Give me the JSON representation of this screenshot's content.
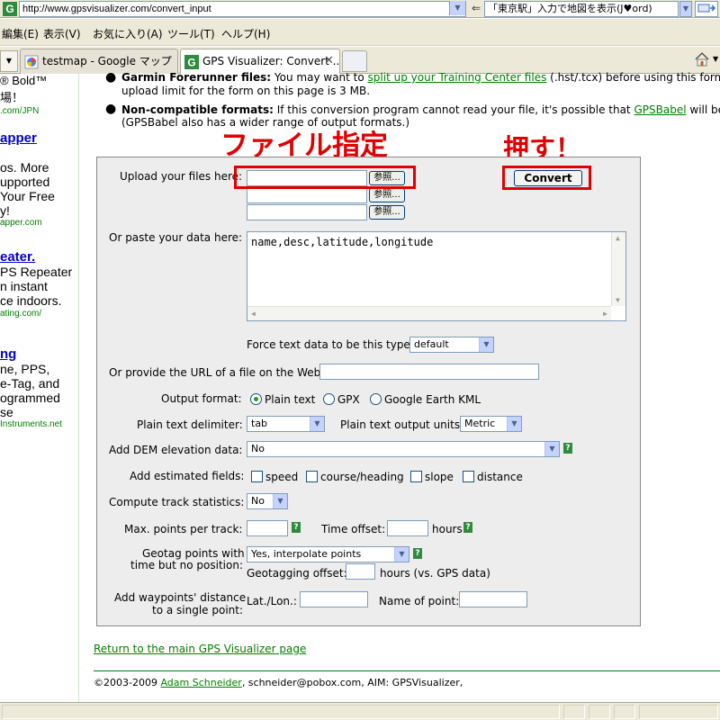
{
  "browser": {
    "url": "http://www.gpsvisualizer.com/convert_input",
    "search_text": "「東京駅」入力で地図を表示(J♥ord)",
    "menu": [
      "編集(E)",
      "表示(V)",
      "お気に入り(A)",
      "ツール(T)",
      "ヘルプ(H)"
    ],
    "tabs": [
      {
        "title": "testmap - Google マップ"
      },
      {
        "title": "GPS Visualizer: Convert ..."
      }
    ]
  },
  "left_ads": {
    "lines": [
      {
        "text": "® Bold™"
      },
      {
        "text": "場！"
      },
      {
        "text": ".com/JPN"
      },
      {
        "text": "apper"
      },
      {
        "text": "os. More"
      },
      {
        "text": "upported"
      },
      {
        "text": "Your Free"
      },
      {
        "text": "y!"
      },
      {
        "text": "apper.com"
      },
      {
        "text": "eater."
      },
      {
        "text": "PS Repeater"
      },
      {
        "text": "n instant"
      },
      {
        "text": "ce indoors."
      },
      {
        "text": "ating.com/"
      },
      {
        "text": "ng"
      },
      {
        "text": "ne, PPS,"
      },
      {
        "text": "e-Tag, and"
      },
      {
        "text": "ogrammed"
      },
      {
        "text": "se"
      },
      {
        "text": "Instruments.net"
      }
    ]
  },
  "intro": {
    "garmin_label": "Garmin Forerunner files:",
    "garmin_text": "You may want to",
    "garmin_link": "split up your Training Center files",
    "garmin_text2": "(.hst/.tcx) before using this form. Th",
    "upload_limit": "upload limit for the form on this page is 3 MB.",
    "noncompat_label": "Non-compatible formats:",
    "noncompat_text": "If this conversion program cannot read your file, it's possible that",
    "noncompat_link": "GPSBabel",
    "noncompat_text2": "will be able",
    "noncompat_line2": "(GPSBabel also has a wider range of output formats.)"
  },
  "annotations": {
    "file_spec": "ファイル指定",
    "press": "押す！"
  },
  "form": {
    "upload_label": "Upload your files here:",
    "browse_label": "参照...",
    "convert_label": "Convert",
    "paste_label": "Or paste your data here:",
    "paste_value": "name,desc,latitude,longitude",
    "force_type_label": "Force text data to be this type:",
    "force_type_value": "default",
    "url_label": "Or provide the URL of a file on the Web:",
    "url_value": "",
    "output_format_label": "Output format:",
    "output_options": [
      "Plain text",
      "GPX",
      "Google Earth KML"
    ],
    "output_selected": "Plain text",
    "delimiter_label": "Plain text delimiter:",
    "delimiter_value": "tab",
    "units_label": "Plain text output units:",
    "units_value": "Metric",
    "dem_label": "Add DEM elevation data:",
    "dem_value": "No",
    "estimated_label": "Add estimated fields:",
    "estimated_options": [
      "speed",
      "course/heading",
      "slope",
      "distance"
    ],
    "stats_label": "Compute track statistics:",
    "stats_value": "No",
    "maxpoints_label": "Max. points per track:",
    "maxpoints_value": "",
    "timeoffset_label": "Time offset:",
    "timeoffset_value": "",
    "hours_label": "hours",
    "geotag_label1": "Geotag points with",
    "geotag_label2": "time but no position:",
    "geotag_value": "Yes, interpolate points",
    "geotag_offset_label": "Geotagging offset:",
    "geotag_offset_value": "",
    "geotag_hours_label": "hours (vs. GPS data)",
    "waypoint_label1": "Add waypoints' distance",
    "waypoint_label2": "to a single point:",
    "latlon_label": "Lat./Lon.:",
    "latlon_value": "",
    "pointname_label": "Name of point:",
    "pointname_value": "",
    "help_glyph": "?"
  },
  "footer": {
    "return_link": "Return to the main GPS Visualizer page",
    "copyright": "©2003-2009",
    "author_link": "Adam Schneider",
    "contact": ", schneider@pobox.com,  AIM: GPSVisualizer,"
  },
  "colors": {
    "accent_link": "#008000",
    "annotation_red": "#e00000",
    "ad_link": "#0000cc"
  }
}
